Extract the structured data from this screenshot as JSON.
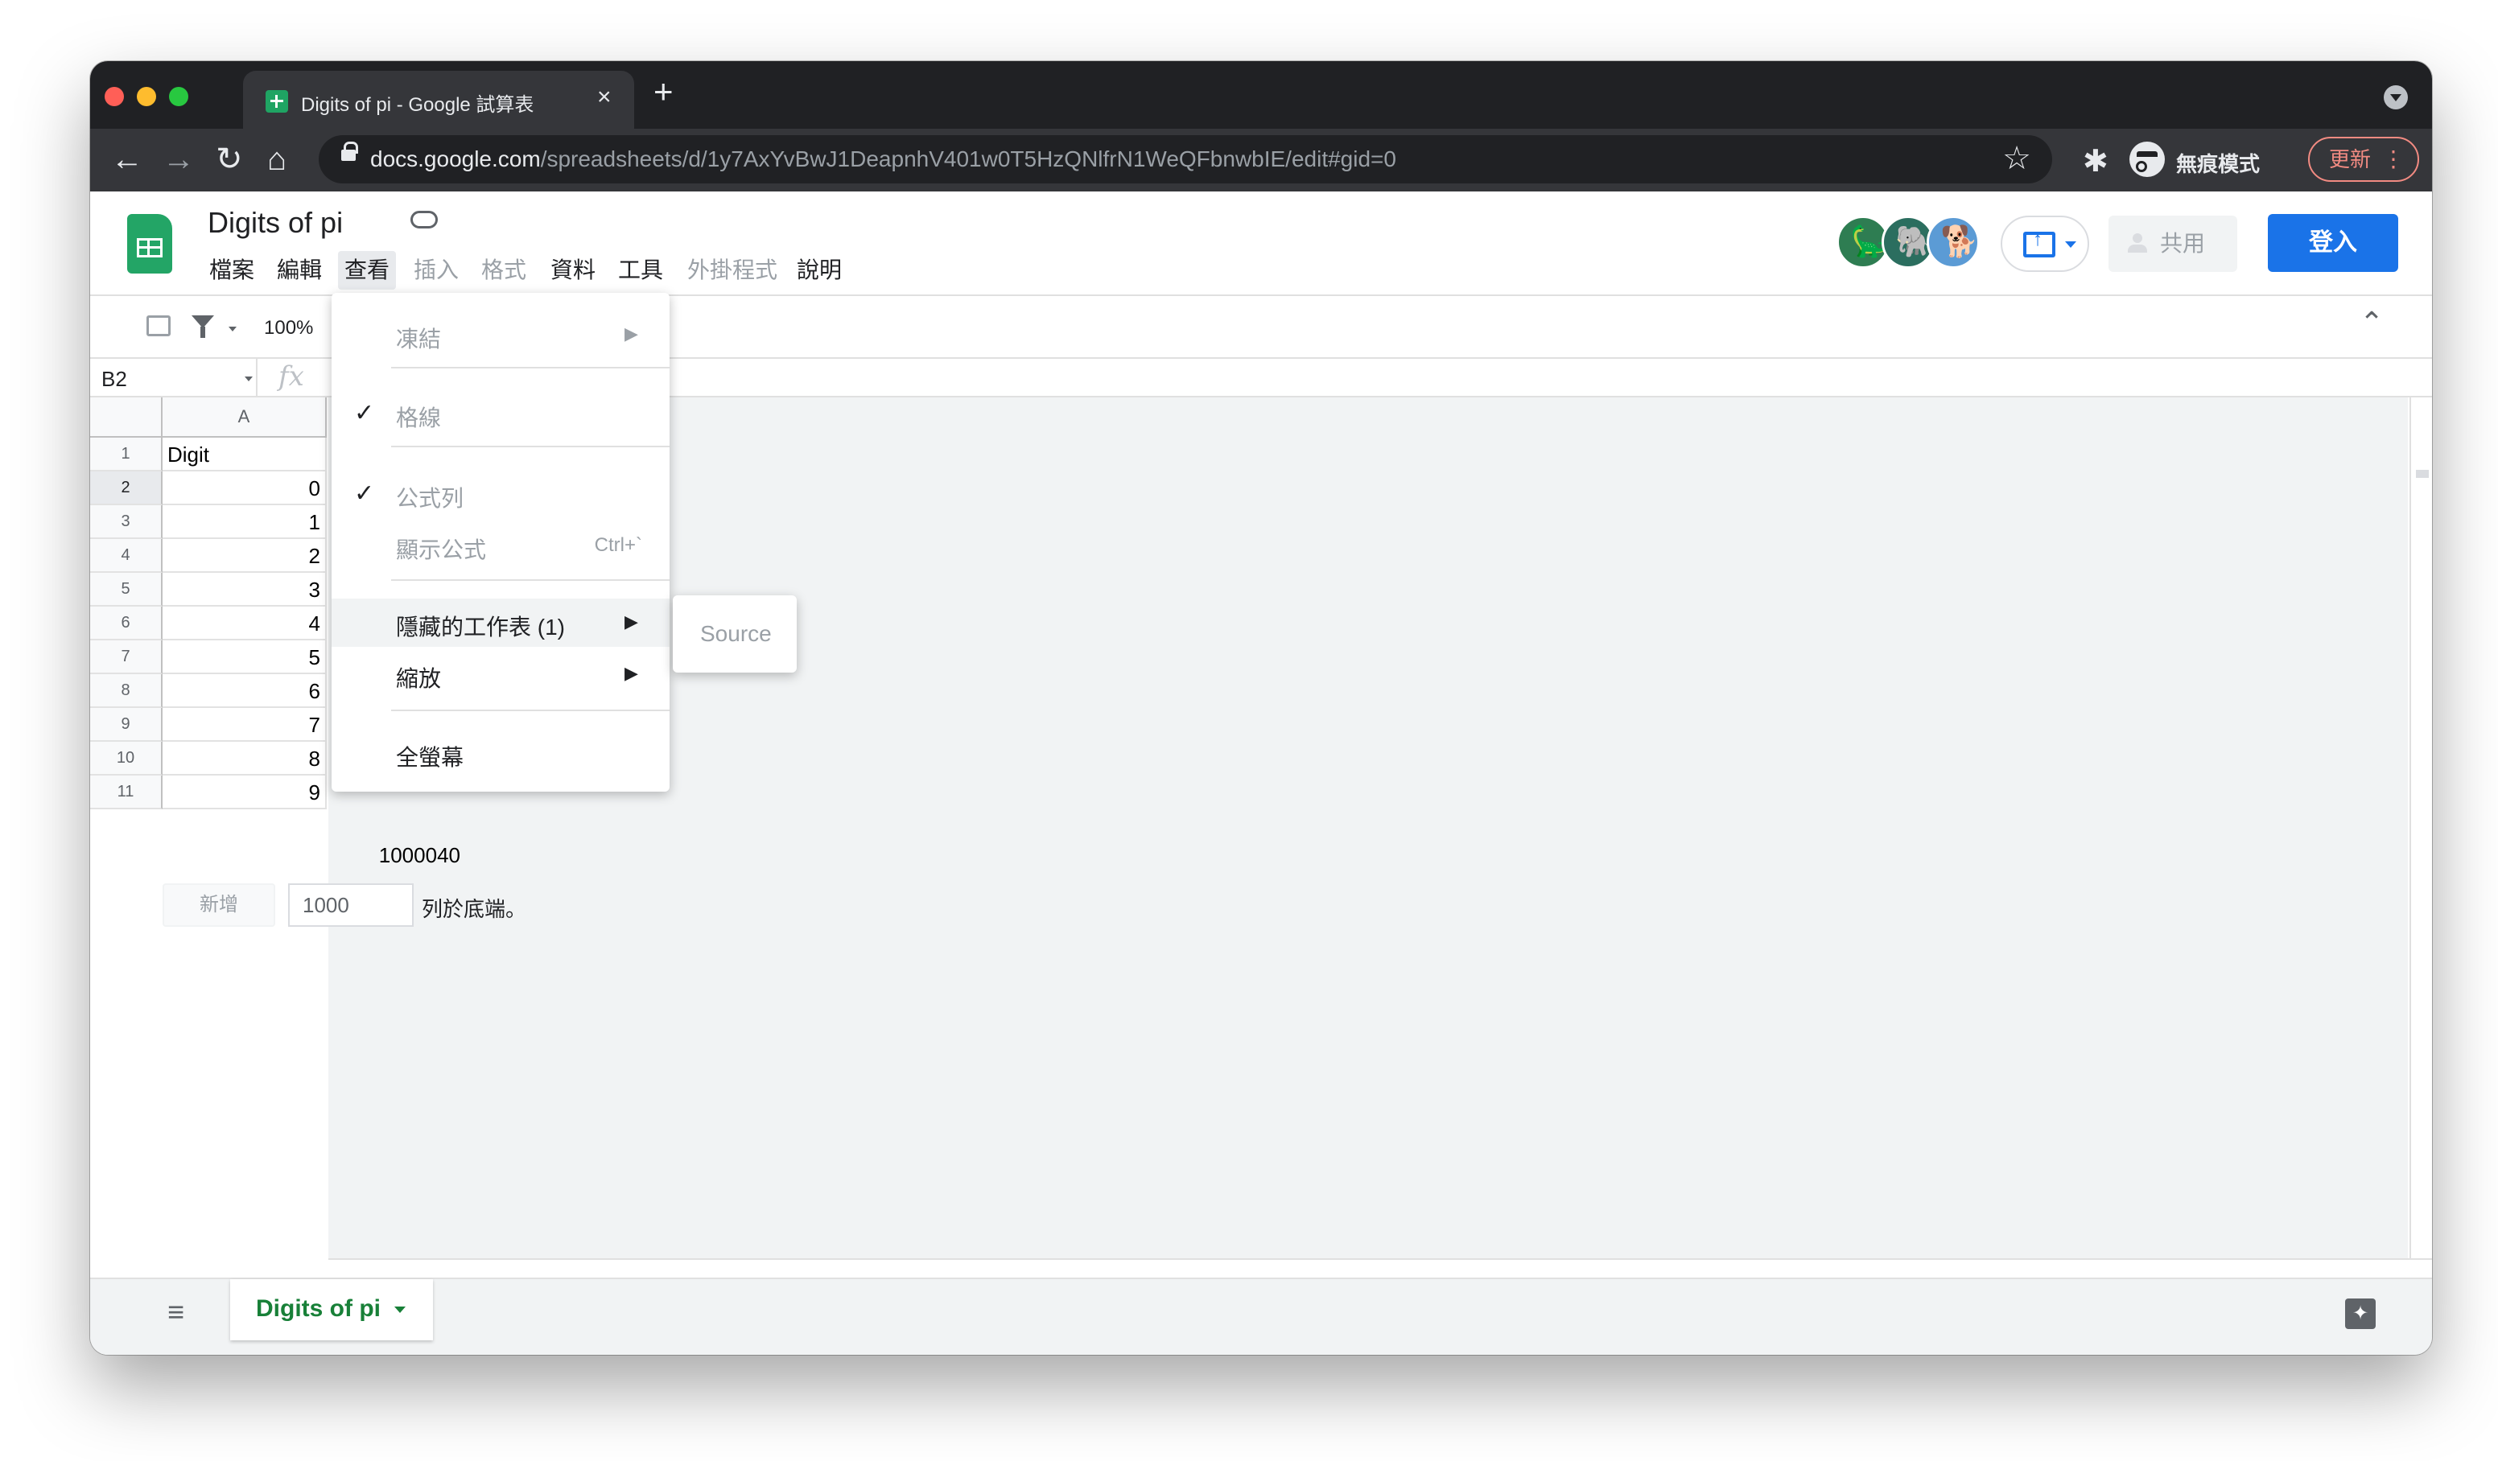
{
  "browser": {
    "tab_title": "Digits of pi - Google 試算表",
    "tab_close_icon": "×",
    "new_tab_icon": "+",
    "url_host": "docs.google.com",
    "url_path": "/spreadsheets/d/1y7AxYvBwJ1DeapnhV401w0T5HzQNlfrN1WeQFbnwbIE/edit#gid=0",
    "back_icon": "←",
    "forward_icon": "→",
    "reload_icon": "↻",
    "home_icon": "⌂",
    "star_icon": "☆",
    "extensions_icon": "✱",
    "incognito_label": "無痕模式",
    "update_label": "更新",
    "update_menu_icon": "⋮",
    "traffic_lights": [
      "#ff5f57",
      "#febc2e",
      "#28c840"
    ]
  },
  "sheets": {
    "title": "Digits of pi",
    "menu": [
      {
        "label": "檔案",
        "state": "normal"
      },
      {
        "label": "編輯",
        "state": "normal"
      },
      {
        "label": "查看",
        "state": "active"
      },
      {
        "label": "插入",
        "state": "disabled"
      },
      {
        "label": "格式",
        "state": "disabled"
      },
      {
        "label": "資料",
        "state": "normal"
      },
      {
        "label": "工具",
        "state": "normal"
      },
      {
        "label": "外掛程式",
        "state": "disabled"
      },
      {
        "label": "說明",
        "state": "normal"
      }
    ],
    "share_label": "共用",
    "signin_label": "登入",
    "avatar_colors": [
      "#2e7d52",
      "#2b6e5f",
      "#5b9bd5"
    ],
    "avatar_glyphs": [
      "🦕",
      "🐘",
      "🐕"
    ],
    "accent_color": "#1a73e8"
  },
  "toolbar": {
    "zoom": "100%",
    "collapse_icon": "⌃"
  },
  "formula_bar": {
    "cell_ref": "B2",
    "fx_label": "fx"
  },
  "grid": {
    "column_headers": [
      "A"
    ],
    "rows": [
      {
        "num": "1",
        "a": "Digit"
      },
      {
        "num": "2",
        "a": "0"
      },
      {
        "num": "3",
        "a": "1"
      },
      {
        "num": "4",
        "a": "2"
      },
      {
        "num": "5",
        "a": "3"
      },
      {
        "num": "6",
        "a": "4"
      },
      {
        "num": "7",
        "a": "5"
      },
      {
        "num": "8",
        "a": "6"
      },
      {
        "num": "9",
        "a": "7"
      },
      {
        "num": "10",
        "a": "8"
      },
      {
        "num": "11",
        "a": "9"
      }
    ],
    "b11_value": "1000040",
    "add_button_label": "新增",
    "add_row_count": "1000",
    "add_rows_suffix": "列於底端。"
  },
  "view_menu": {
    "items": [
      {
        "label": "凍結",
        "checked": false,
        "submenu": true,
        "disabled": true
      },
      {
        "label": "格線",
        "checked": true,
        "submenu": false,
        "disabled": true
      },
      {
        "label": "公式列",
        "checked": true,
        "submenu": false,
        "disabled": true
      },
      {
        "label": "顯示公式",
        "checked": false,
        "submenu": false,
        "disabled": true,
        "shortcut": "Ctrl+`"
      },
      {
        "label": "隱藏的工作表 (1)",
        "checked": false,
        "submenu": true,
        "disabled": false,
        "highlight": true
      },
      {
        "label": "縮放",
        "checked": false,
        "submenu": true,
        "disabled": false
      },
      {
        "label": "全螢幕",
        "checked": false,
        "submenu": false,
        "disabled": false
      }
    ],
    "check_icon": "✓",
    "submenu_arrow": "▶"
  },
  "hidden_sheets_submenu": {
    "items": [
      "Source"
    ]
  },
  "sheet_tabs": {
    "all_sheets_icon": "≡",
    "active_tab": "Digits of pi",
    "explore_icon": "✦"
  }
}
